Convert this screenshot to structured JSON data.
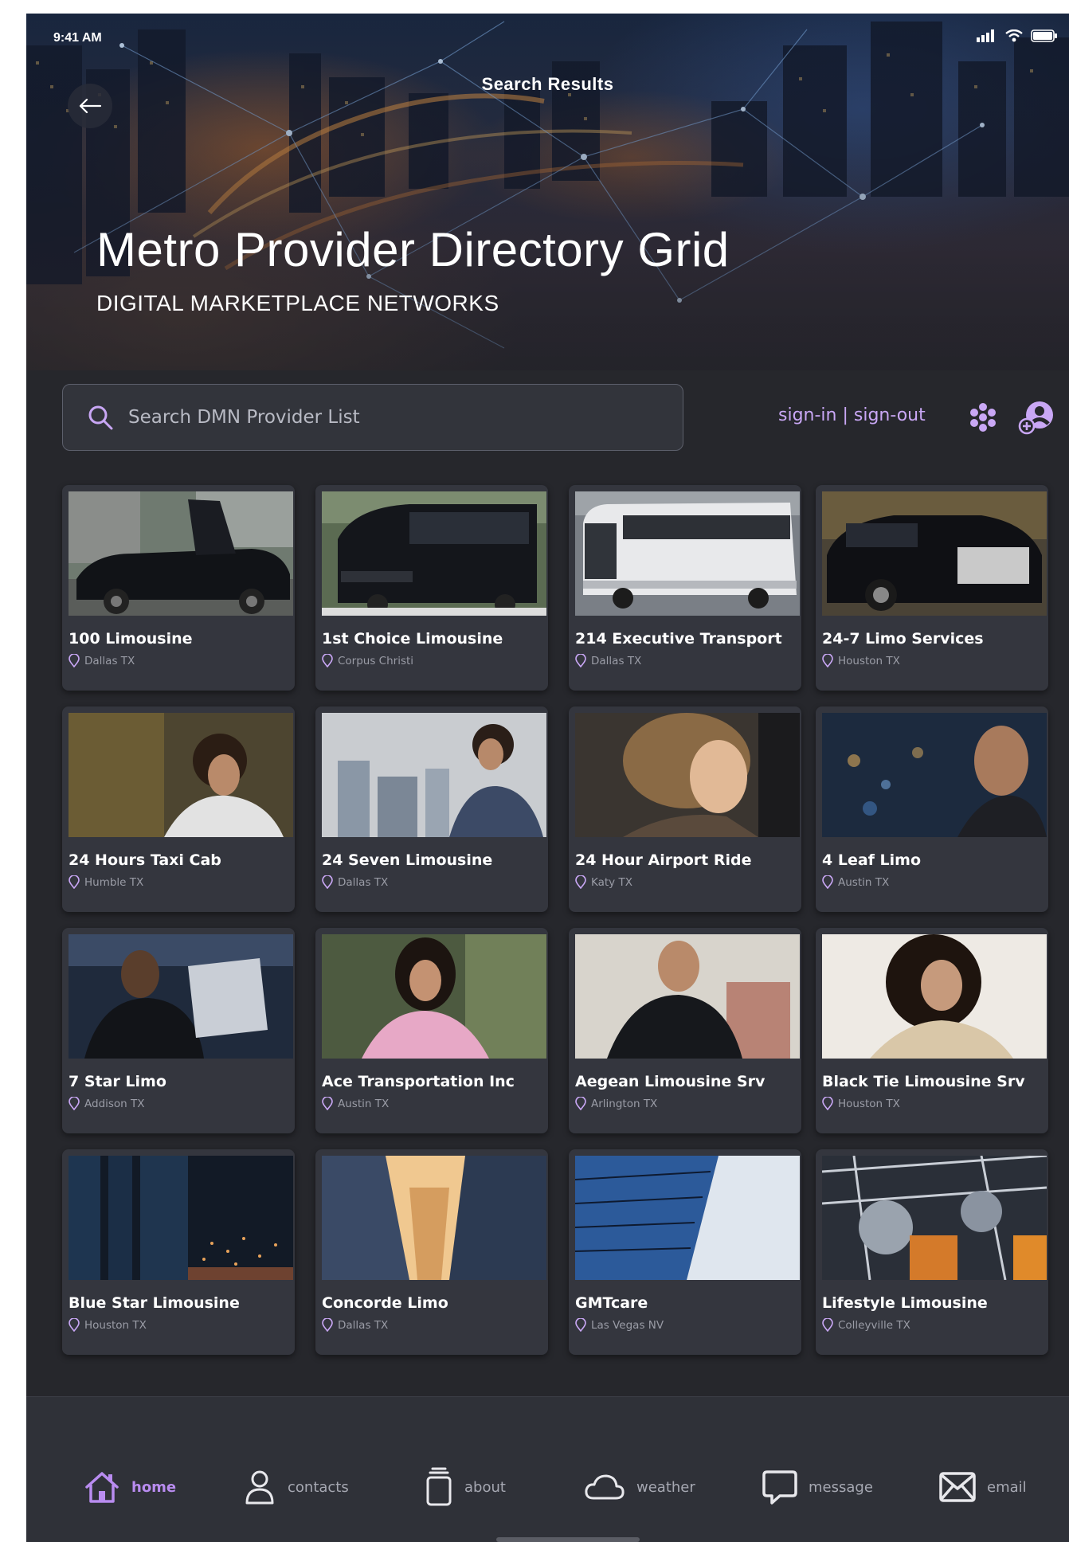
{
  "status_bar": {
    "time": "9:41 AM"
  },
  "header": {
    "screen_title": "Search Results",
    "title": "Metro Provider Directory Grid",
    "subtitle": "DIGITAL MARKETPLACE NETWORKS"
  },
  "search": {
    "placeholder": "Search DMN Provider List",
    "value": ""
  },
  "auth": {
    "label": "sign-in | sign-out"
  },
  "colors": {
    "accent": "#b98cf0",
    "background": "#26272c",
    "card": "#34363e"
  },
  "providers": [
    {
      "name": "100 Limousine",
      "location": "Dallas TX",
      "image": "limousine"
    },
    {
      "name": "1st Choice Limousine",
      "location": "Corpus Christi",
      "image": "sprinter-van"
    },
    {
      "name": "214 Executive Transport",
      "location": "Dallas TX",
      "image": "coach-bus"
    },
    {
      "name": "24-7 Limo Services",
      "location": "Houston TX",
      "image": "luxury-sedan"
    },
    {
      "name": "24 Hours Taxi Cab",
      "location": "Humble TX",
      "image": "woman-in-car"
    },
    {
      "name": "24 Seven Limousine",
      "location": "Dallas TX",
      "image": "woman-at-window"
    },
    {
      "name": "24 Hour Airport Ride",
      "location": "Katy TX",
      "image": "woman-profile"
    },
    {
      "name": "4 Leaf Limo",
      "location": "Austin TX",
      "image": "man-city-night"
    },
    {
      "name": "7 Star Limo",
      "location": "Addison TX",
      "image": "man-with-tablet"
    },
    {
      "name": "Ace Transportation Inc",
      "location": "Austin TX",
      "image": "woman-pink-jacket"
    },
    {
      "name": "Aegean Limousine Srv",
      "location": "Arlington TX",
      "image": "man-with-phone"
    },
    {
      "name": "Black Tie Limousine Srv",
      "location": "Houston TX",
      "image": "woman-curly-hair"
    },
    {
      "name": "Blue Star Limousine",
      "location": "Houston TX",
      "image": "city-night-skyline"
    },
    {
      "name": "Concorde Limo",
      "location": "Dallas TX",
      "image": "skyscrapers-sunset"
    },
    {
      "name": "GMTcare",
      "location": "Las Vegas NV",
      "image": "glass-tower"
    },
    {
      "name": "Lifestyle Limousine",
      "location": "Colleyville TX",
      "image": "elevator-lights"
    }
  ],
  "nav": {
    "home": "home",
    "contacts": "contacts",
    "about": "about",
    "weather": "weather",
    "message": "message",
    "email": "email"
  }
}
